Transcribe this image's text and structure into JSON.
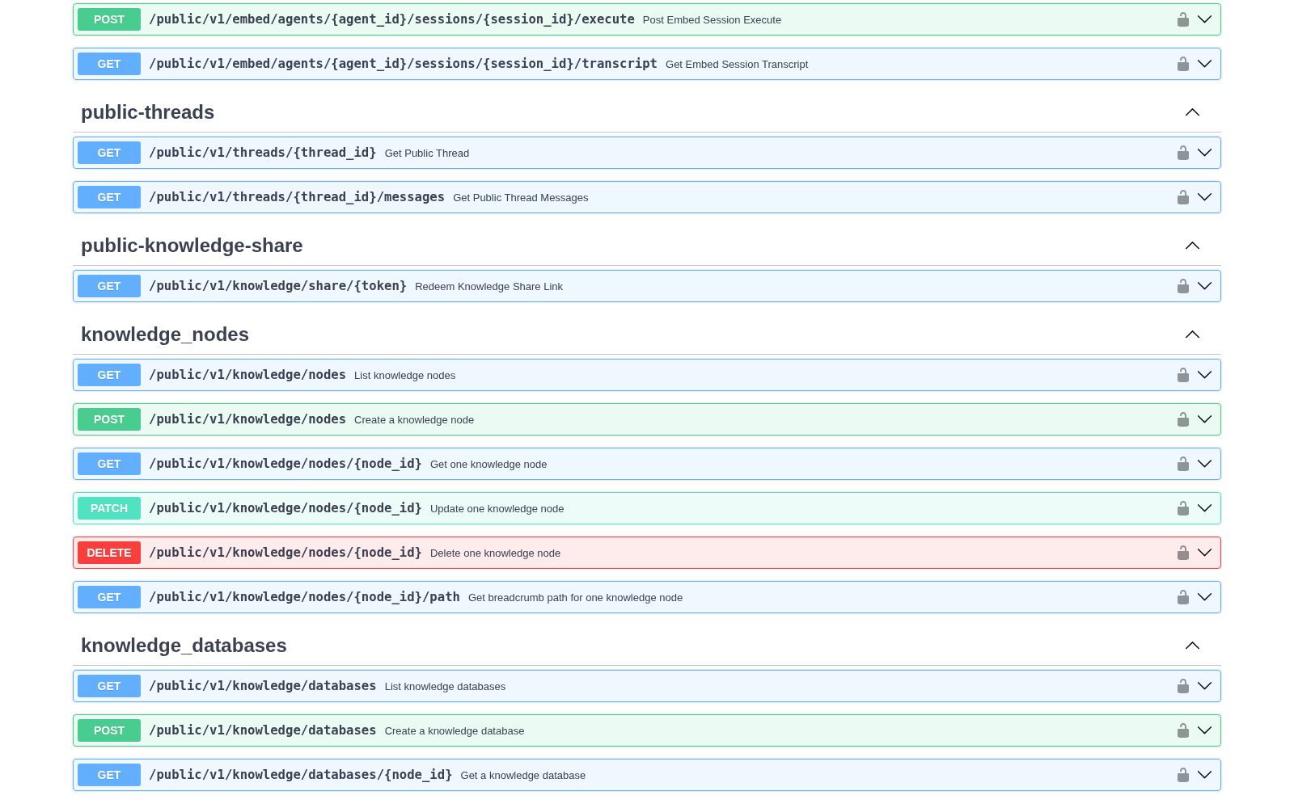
{
  "sections": [
    {
      "operations": [
        {
          "method": "POST",
          "color": "#49cc90",
          "path": "/public/v1/embed/agents/{agent_id}/sessions/{session_id}/execute",
          "summary": "Post Embed Session Execute",
          "locked": false,
          "expanded": false
        },
        {
          "method": "GET",
          "color": "#61affe",
          "path": "/public/v1/embed/agents/{agent_id}/sessions/{session_id}/transcript",
          "summary": "Get Embed Session Transcript",
          "locked": false,
          "expanded": false
        }
      ]
    },
    {
      "title": "public-threads",
      "expanded": true,
      "operations": [
        {
          "method": "GET",
          "color": "#61affe",
          "path": "/public/v1/threads/{thread_id}",
          "summary": "Get Public Thread",
          "locked": false,
          "expanded": false
        },
        {
          "method": "GET",
          "color": "#61affe",
          "path": "/public/v1/threads/{thread_id}/messages",
          "summary": "Get Public Thread Messages",
          "locked": false,
          "expanded": false
        }
      ]
    },
    {
      "title": "public-knowledge-share",
      "expanded": true,
      "operations": [
        {
          "method": "GET",
          "color": "#61affe",
          "path": "/public/v1/knowledge/share/{token}",
          "summary": "Redeem Knowledge Share Link",
          "locked": false,
          "expanded": false
        }
      ]
    },
    {
      "title": "knowledge_nodes",
      "expanded": true,
      "operations": [
        {
          "method": "GET",
          "color": "#61affe",
          "path": "/public/v1/knowledge/nodes",
          "summary": "List knowledge nodes",
          "locked": false,
          "expanded": false
        },
        {
          "method": "POST",
          "color": "#49cc90",
          "path": "/public/v1/knowledge/nodes",
          "summary": "Create a knowledge node",
          "locked": false,
          "expanded": false
        },
        {
          "method": "GET",
          "color": "#61affe",
          "path": "/public/v1/knowledge/nodes/{node_id}",
          "summary": "Get one knowledge node",
          "locked": false,
          "expanded": false
        },
        {
          "method": "PATCH",
          "color": "#50e3c2",
          "path": "/public/v1/knowledge/nodes/{node_id}",
          "summary": "Update one knowledge node",
          "locked": false,
          "expanded": false
        },
        {
          "method": "DELETE",
          "color": "#f93e3e",
          "path": "/public/v1/knowledge/nodes/{node_id}",
          "summary": "Delete one knowledge node",
          "locked": false,
          "expanded": false
        },
        {
          "method": "GET",
          "color": "#61affe",
          "path": "/public/v1/knowledge/nodes/{node_id}/path",
          "summary": "Get breadcrumb path for one knowledge node",
          "locked": false,
          "expanded": false
        }
      ]
    },
    {
      "title": "knowledge_databases",
      "expanded": true,
      "operations": [
        {
          "method": "GET",
          "color": "#61affe",
          "path": "/public/v1/knowledge/databases",
          "summary": "List knowledge databases",
          "locked": false,
          "expanded": false
        },
        {
          "method": "POST",
          "color": "#49cc90",
          "path": "/public/v1/knowledge/databases",
          "summary": "Create a knowledge database",
          "locked": false,
          "expanded": false
        },
        {
          "method": "GET",
          "color": "#61affe",
          "path": "/public/v1/knowledge/databases/{node_id}",
          "summary": "Get a knowledge database",
          "locked": false,
          "expanded": false
        }
      ]
    }
  ]
}
